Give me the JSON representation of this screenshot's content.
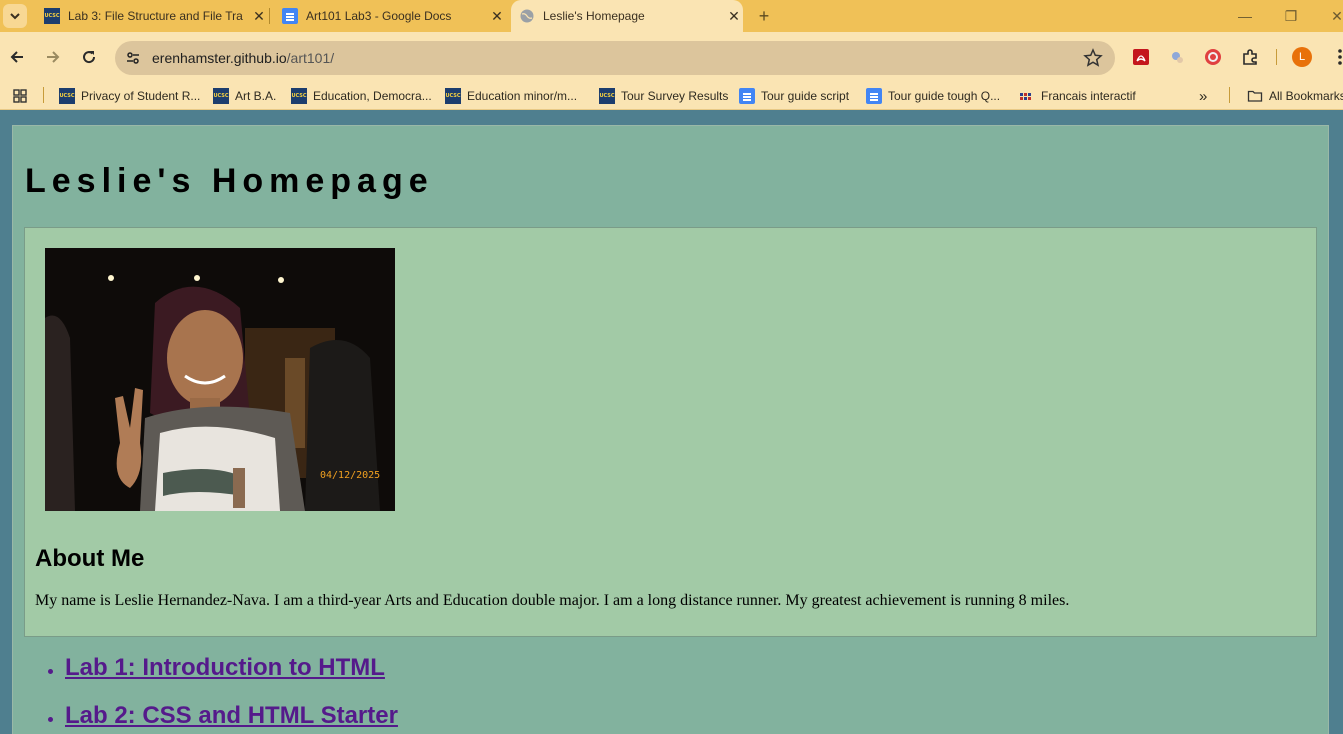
{
  "browser": {
    "tabs": [
      {
        "title": "Lab 3: File Structure and File Tra",
        "icon": "ucsc-icon",
        "active": false
      },
      {
        "title": "Art101 Lab3 - Google Docs",
        "icon": "google-docs-icon",
        "active": false
      },
      {
        "title": "Leslie's Homepage",
        "icon": "globe-icon",
        "active": true
      }
    ],
    "address": {
      "host": "erenhamster.github.io",
      "path": "/art101/"
    },
    "profile_initial": "L",
    "bookmarks": [
      {
        "label": "Privacy of Student R...",
        "icon": "ucsc-icon"
      },
      {
        "label": "Art B.A.",
        "icon": "ucsc-icon"
      },
      {
        "label": "Education, Democra...",
        "icon": "ucsc-icon"
      },
      {
        "label": "Education minor/m...",
        "icon": "ucsc-icon"
      },
      {
        "label": "Tour Survey Results",
        "icon": "ucsc-icon"
      },
      {
        "label": "Tour guide script",
        "icon": "google-docs-icon"
      },
      {
        "label": "Tour guide tough Q...",
        "icon": "google-docs-icon"
      },
      {
        "label": "Francais interactif",
        "icon": "grid-icon"
      }
    ],
    "all_bookmarks_label": "All Bookmarks"
  },
  "page": {
    "title": "Leslie's Homepage",
    "photo_date_stamp": "04/12/2025",
    "about_heading": "About Me",
    "about_text": "My name is Leslie Hernandez-Nava. I am a third-year Arts and Education double major. I am a long distance runner. My greatest achievement is running 8 miles.",
    "labs": [
      "Lab 1: Introduction to HTML",
      "Lab 2: CSS and HTML Starter"
    ]
  },
  "colors": {
    "page_background": "#82b29e",
    "about_background": "#a2caa6",
    "link_color": "#551a8b",
    "browser_frame": "#f0c157"
  }
}
